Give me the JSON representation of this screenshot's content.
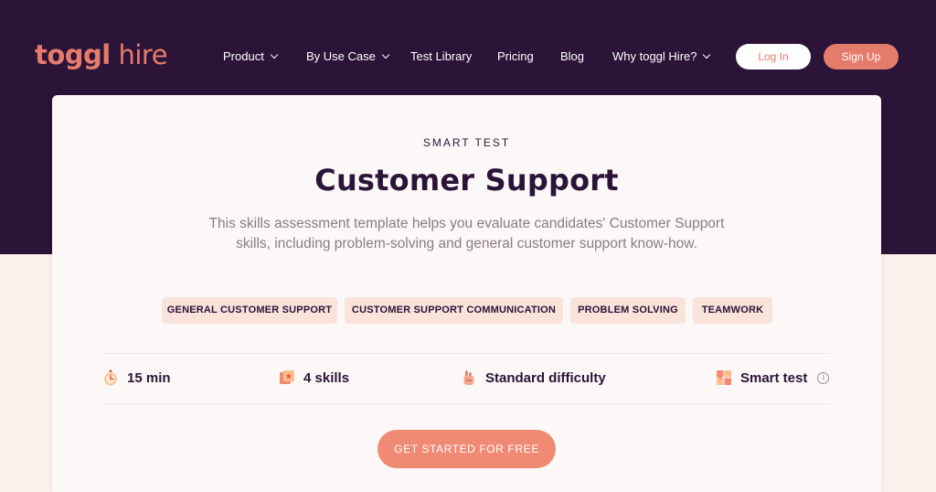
{
  "nav": {
    "logo_bold": "toggl",
    "logo_light": " hire",
    "items": [
      "Product",
      "By Use Case",
      "Test Library",
      "Pricing",
      "Blog",
      "Why toggl Hire?"
    ],
    "login_label": "Log In",
    "signup_label": "Sign Up"
  },
  "test": {
    "eyebrow": "SMART TEST",
    "title": "Customer Support",
    "description": "This skills assessment template helps you evaluate candidates' Customer Support skills, including problem-solving and general customer support know-how.",
    "tags": [
      "GENERAL CUSTOMER SUPPORT",
      "CUSTOMER SUPPORT COMMUNICATION",
      "PROBLEM SOLVING",
      "TEAMWORK"
    ],
    "stats": {
      "duration": "15 min",
      "skills": "4 skills",
      "difficulty": "Standard difficulty",
      "type": "Smart test"
    },
    "cta_label": "GET STARTED FOR FREE"
  },
  "colors": {
    "brand_dark": "#2c1338",
    "accent": "#e57c6b",
    "tag_bg": "#fae3db"
  },
  "icons": [
    "stopwatch-icon",
    "skills-icon",
    "hand-difficulty-icon",
    "puzzle-icon",
    "info-icon",
    "chevron-down-icon"
  ]
}
